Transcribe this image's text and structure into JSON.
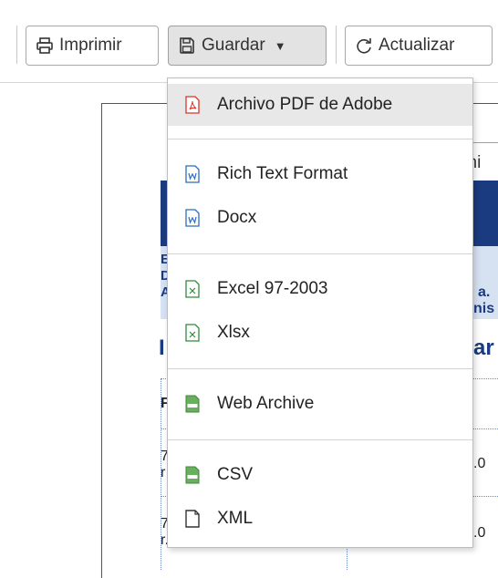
{
  "toolbar": {
    "print_label": "Imprimir",
    "save_label": "Guardar",
    "save_caret": "▼",
    "refresh_label": "Actualizar"
  },
  "report": {
    "tab_label": "Archi",
    "left_col_text": [
      "E",
      "D",
      "A"
    ],
    "right_col_text": [
      "a.",
      "nis"
    ],
    "left_big": "I",
    "right_big": "ar",
    "row_f": "F",
    "row1_left": [
      "7",
      "r"
    ],
    "row1_right": ".0",
    "row2_left": [
      "7",
      "r..."
    ],
    "row2_right": ".0"
  },
  "menu": {
    "items": [
      {
        "label": "Archivo PDF de Adobe",
        "icon": "pdf-file-icon",
        "color": "#d9342b"
      },
      {
        "label": "Rich Text Format",
        "icon": "word-file-icon",
        "color": "#2b6cc4"
      },
      {
        "label": "Docx",
        "icon": "word-file-icon",
        "color": "#2b6cc4"
      },
      {
        "label": "Excel 97-2003",
        "icon": "excel-file-icon",
        "color": "#2e8b3a"
      },
      {
        "label": "Xlsx",
        "icon": "excel-file-icon",
        "color": "#2e8b3a"
      },
      {
        "label": "Web Archive",
        "icon": "html-file-icon",
        "color": "#5aa35a"
      },
      {
        "label": "CSV",
        "icon": "csv-file-icon",
        "color": "#5aa35a"
      },
      {
        "label": "XML",
        "icon": "blank-file-icon",
        "color": "#333333"
      }
    ]
  },
  "colors": {
    "report_band": "#1a3b7f",
    "report_text": "#1a3b7f",
    "menu_hover": "#e8e8e8"
  }
}
